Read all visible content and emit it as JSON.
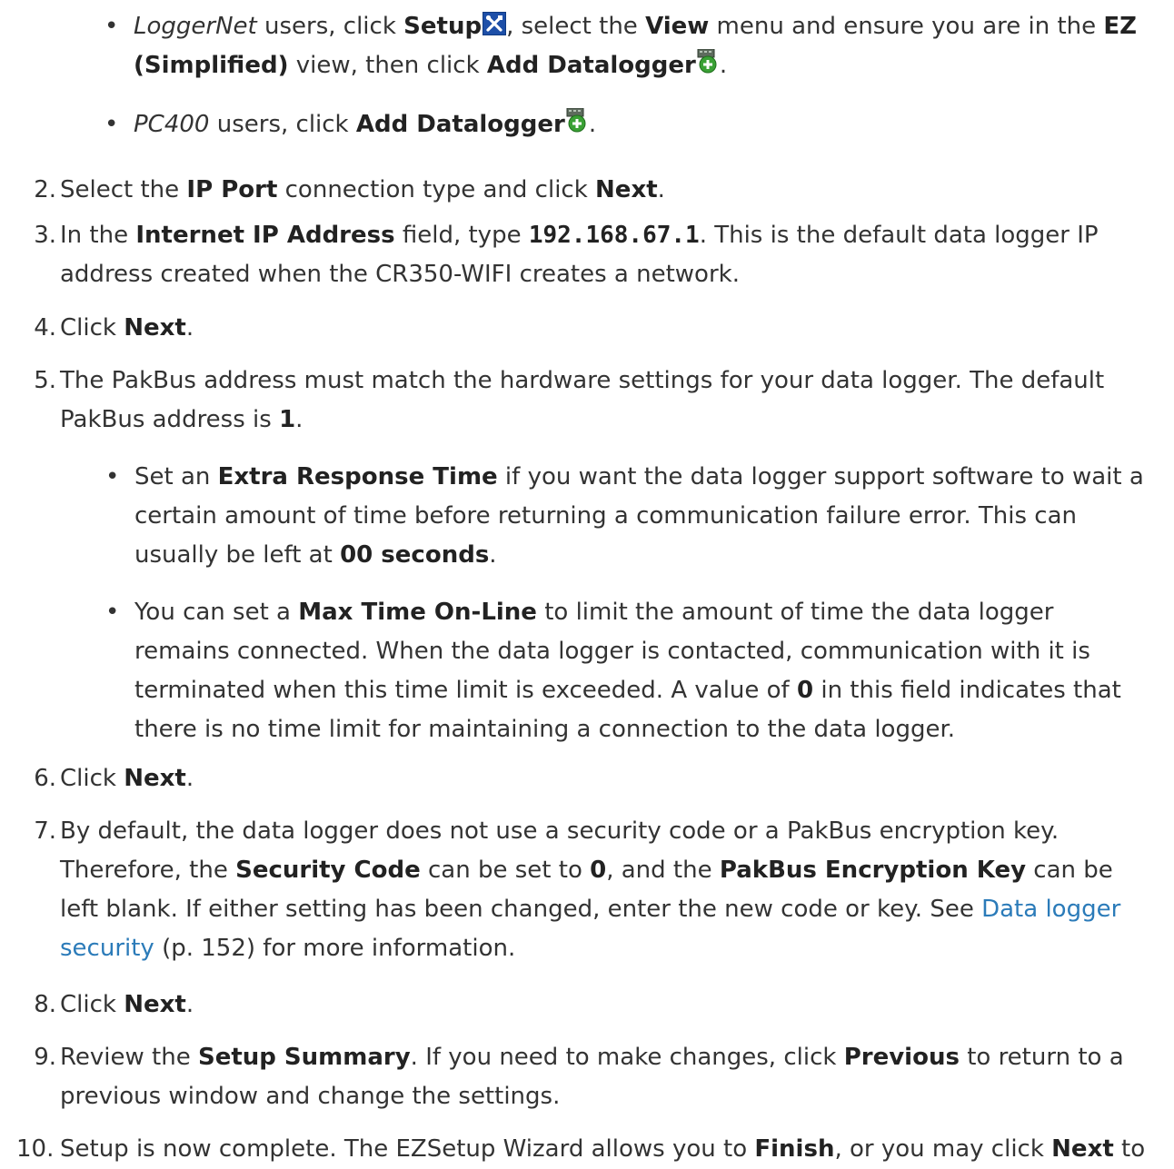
{
  "bullets": {
    "loggernet": {
      "product": "LoggerNet",
      "t1": " users, click ",
      "setup": "Setup",
      "t2": ", select the ",
      "view": "View",
      "t3": " menu and ensure you are in the ",
      "ez": "EZ (Simplified)",
      "t4": " view, then click ",
      "add": "Add Datalogger",
      "t5": "."
    },
    "pc400": {
      "product": "PC400",
      "t1": " users, click ",
      "add": "Add Datalogger",
      "t2": "."
    }
  },
  "steps": {
    "s2": {
      "num": "2.",
      "t1": "Select the ",
      "b1": "IP Port",
      "t2": " connection type and click ",
      "b2": "Next",
      "t3": "."
    },
    "s3": {
      "num": "3.",
      "t1": "In the ",
      "b1": "Internet IP Address",
      "t2": " field, type ",
      "code": "192.168.67.1",
      "t3": ". This is the default data logger IP address created when the CR350-WIFI creates a network."
    },
    "s4": {
      "num": "4.",
      "t1": "Click ",
      "b1": "Next",
      "t2": "."
    },
    "s5": {
      "num": "5.",
      "t1": "The PakBus address must match the hardware settings for your data logger. The default PakBus address is ",
      "b1": "1",
      "t2": ".",
      "sub1": {
        "t1": "Set an ",
        "b1": "Extra Response Time",
        "t2": " if you want the data logger support software to wait a certain amount of time before returning a communication failure error. This can usually be left at ",
        "b2": "00 seconds",
        "t3": "."
      },
      "sub2": {
        "t1": "You can set a ",
        "b1": "Max Time On-Line",
        "t2": " to limit the amount of time the data logger remains connected. When the data logger is contacted, communication with it is terminated when this time limit is exceeded. A value of ",
        "b2": "0",
        "t3": " in this field indicates that there is no time limit for maintaining a connection to the data logger."
      }
    },
    "s6": {
      "num": "6.",
      "t1": "Click ",
      "b1": "Next",
      "t2": "."
    },
    "s7": {
      "num": "7.",
      "t1": "By default, the data logger does not use a security code or a PakBus encryption key. Therefore, the ",
      "b1": "Security Code",
      "t2": " can be set to ",
      "b2": "0",
      "t3": ", and the ",
      "b3": "PakBus Encryption Key",
      "t4": " can be left blank. If either setting has been changed, enter the new code or key. See ",
      "link": "Data logger security",
      "t5": " (p. 152) for more information."
    },
    "s8": {
      "num": "8.",
      "t1": "Click ",
      "b1": "Next",
      "t2": "."
    },
    "s9": {
      "num": "9.",
      "t1": "Review the ",
      "b1": "Setup Summary",
      "t2": ". If you need to make changes, click ",
      "b2": "Previous",
      "t3": " to return to a previous window and change the settings."
    },
    "s10": {
      "num": "10.",
      "t1": "Setup is now complete. The EZSetup Wizard allows you to ",
      "b1": "Finish",
      "t2": ", or you may click ",
      "b2": "Next",
      "t3": " to"
    }
  },
  "icons": {
    "setup": "setup-tools-icon",
    "add_datalogger": "add-datalogger-icon"
  }
}
